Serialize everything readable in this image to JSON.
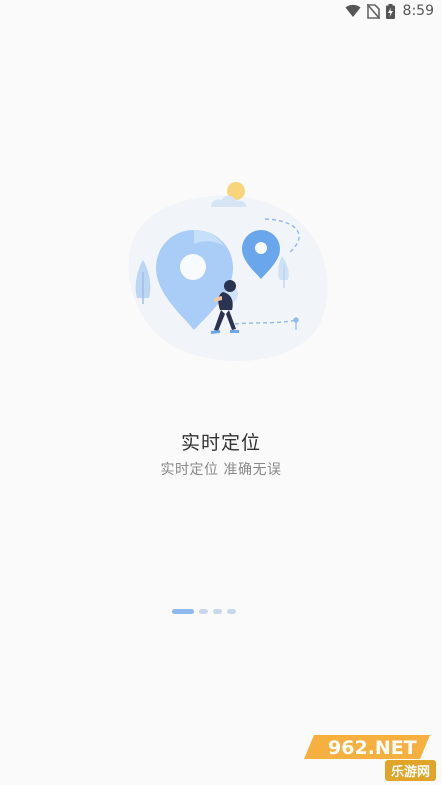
{
  "status_bar": {
    "time": "8:59",
    "icons": [
      "wifi-icon",
      "no-sim-icon",
      "battery-charging-icon"
    ]
  },
  "onboarding": {
    "title": "实时定位",
    "subtitle": "实时定位 准确无误",
    "illustration": "location-pin-illustration",
    "pages_total": 4,
    "current_page": 1
  },
  "watermark": {
    "logo_text": "962.NET",
    "caption": "乐游网"
  },
  "colors": {
    "background": "#fafafb",
    "accent_blue": "#6aa6ec",
    "indicator_active": "#8fb8ec",
    "indicator_inactive": "#c9d7ea"
  }
}
